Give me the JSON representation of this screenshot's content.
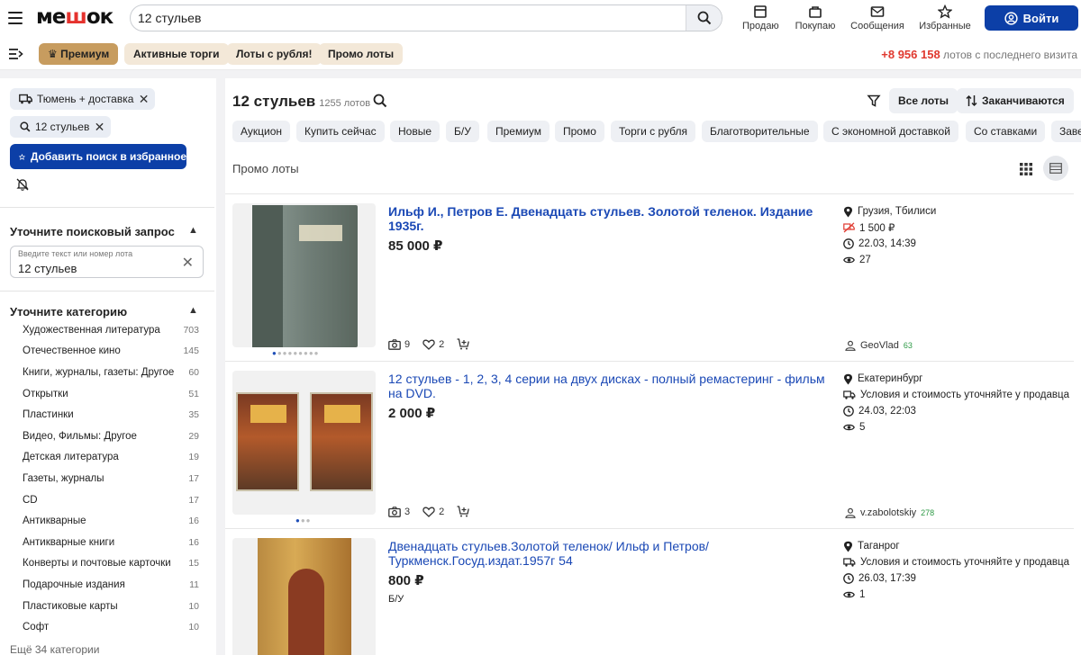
{
  "header": {
    "logo_prefix": "ме",
    "logo_accent": "ш",
    "logo_suffix": "ок",
    "search_value": "12 стульев",
    "nav": [
      "Продаю",
      "Покупаю",
      "Сообщения",
      "Избранные"
    ],
    "login_label": "Войти"
  },
  "subbar": {
    "pills": [
      "Премиум",
      "Активные торги",
      "Лоты с рубля!",
      "Промо лоты"
    ],
    "visits_count": "+8 956 158",
    "visits_text": "лотов с последнего визита"
  },
  "sidebar": {
    "chips": [
      "Тюмень + доставка",
      "12 стульев"
    ],
    "fav_label": "Добавить поиск в избранное",
    "refine_title": "Уточните поисковый запрос",
    "query_placeholder": "Введите текст или номер лота",
    "query_value": "12 стульев",
    "category_title": "Уточните категорию",
    "categories": [
      {
        "name": "Художественная литература",
        "count": "703"
      },
      {
        "name": "Отечественное кино",
        "count": "145"
      },
      {
        "name": "Книги, журналы, газеты: Другое",
        "count": "60"
      },
      {
        "name": "Открытки",
        "count": "51"
      },
      {
        "name": "Пластинки",
        "count": "35"
      },
      {
        "name": "Видео, Фильмы: Другое",
        "count": "29"
      },
      {
        "name": "Детская литература",
        "count": "19"
      },
      {
        "name": "Газеты, журналы",
        "count": "17"
      },
      {
        "name": "CD",
        "count": "17"
      },
      {
        "name": "Антикварные",
        "count": "16"
      },
      {
        "name": "Антикварные книги",
        "count": "16"
      },
      {
        "name": "Конверты и почтовые карточки",
        "count": "15"
      },
      {
        "name": "Подарочные издания",
        "count": "11"
      },
      {
        "name": "Пластиковые карты",
        "count": "10"
      },
      {
        "name": "Софт",
        "count": "10"
      }
    ],
    "more_categories": "Ещё 34 категории"
  },
  "main": {
    "title": "12 стульев",
    "lot_count": "1255 лотов",
    "sort_all": "Все лоты",
    "sort_ending": "Заканчиваются",
    "filters": [
      "Аукцион",
      "Купить сейчас",
      "Новые",
      "Б/У",
      "Премиум",
      "Промо",
      "Торги с рубля",
      "Благотворительные",
      "С экономной доставкой",
      "Со ставками",
      "Заве"
    ],
    "promo_label": "Промо лоты"
  },
  "listings": [
    {
      "title": "Ильф И., Петров Е. Двенадцать стульев. Золотой теленок. Издание 1935г.",
      "price": "85 000 ₽",
      "condition": "",
      "photos": "9",
      "likes": "2",
      "location": "Грузия, Тбилиси",
      "delivery": "1 500 ₽",
      "date": "22.03, 14:39",
      "views": "27",
      "seller": "GeoVlad",
      "rating": "63"
    },
    {
      "title": "12 стульев - 1, 2, 3, 4 серии на двух дисках - полный ремастеринг - фильм на DVD.",
      "price": "2 000 ₽",
      "condition": "",
      "photos": "3",
      "likes": "2",
      "location": "Екатеринбург",
      "delivery": "Условия и стоимость уточняйте у продавца",
      "date": "24.03, 22:03",
      "views": "5",
      "seller": "v.zabolotskiy",
      "rating": "278"
    },
    {
      "title": "Двенадцать стульев.Золотой теленок/ Ильф и Петров/ Туркменск.Госуд.издат.1957г 54",
      "price": "800 ₽",
      "condition": "Б/У",
      "location": "Таганрог",
      "delivery": "Условия и стоимость уточняйте у продавца",
      "date": "26.03, 17:39",
      "views": "1"
    }
  ],
  "colors": {
    "primary": "#0c3fa7",
    "link": "#1a48b5",
    "accent_red": "#e0392f",
    "premium": "#c79c5f"
  }
}
